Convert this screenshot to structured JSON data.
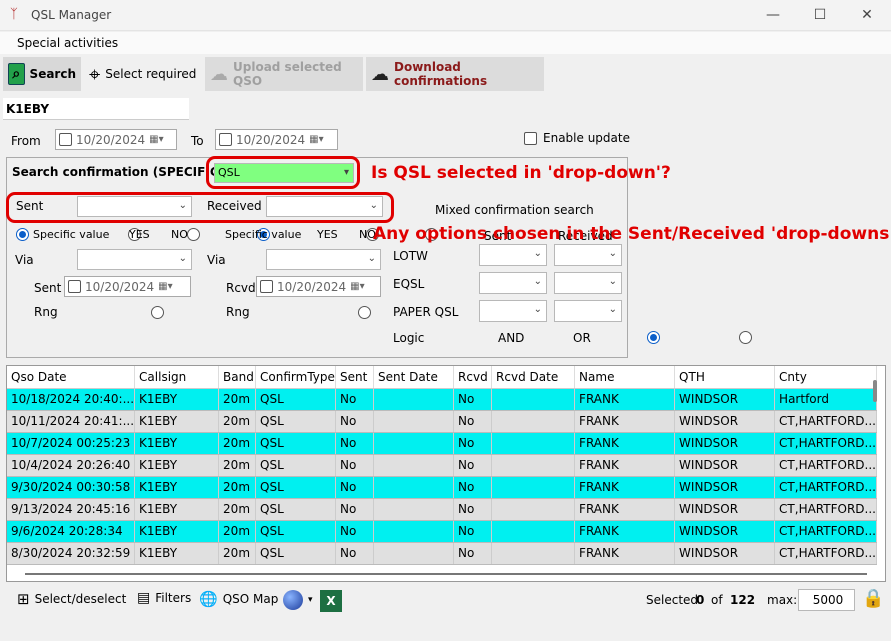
{
  "window": {
    "title": "QSL Manager",
    "minimize": "—",
    "maximize": "☐",
    "close": "✕"
  },
  "menu": {
    "special": "Special activities"
  },
  "toolbar": {
    "search": "Search",
    "select_required": "Select required",
    "upload": "Upload selected QSO",
    "download": "Download confirmations"
  },
  "callsign": "K1EBY",
  "dates": {
    "from_label": "From",
    "from_value": "10/20/2024",
    "to_label": "To",
    "to_value": "10/20/2024",
    "enable_update": "Enable update"
  },
  "search_conf": {
    "label": "Search confirmation (SPECIFIC)",
    "value": "QSL",
    "annotation": "Is QSL selected in 'drop-down'?"
  },
  "sent": {
    "label": "Sent",
    "value": "",
    "specific": "Specific value",
    "yes": "YES",
    "no": "NO",
    "via_label": "Via",
    "via_value": "",
    "date_label": "Sent",
    "date_value": "10/20/2024",
    "rng": "Rng"
  },
  "received": {
    "label": "Received",
    "value": "",
    "specific": "Specific value",
    "yes": "YES",
    "no": "NO",
    "via_label": "Via",
    "via_value": "",
    "date_label": "Rcvd",
    "date_value": "10/20/2024",
    "rng": "Rng"
  },
  "annotation2": "Any options chosen in the Sent/Received 'drop-downs'?",
  "mixed": {
    "title": "Mixed confirmation search",
    "sent_hdr": "Sent",
    "rcvd_hdr": "Received",
    "rows": [
      "LOTW",
      "EQSL",
      "PAPER QSL"
    ],
    "logic_label": "Logic",
    "and": "AND",
    "or": "OR"
  },
  "table": {
    "columns": [
      "Qso Date",
      "Callsign",
      "Band",
      "ConfirmType",
      "Sent",
      "Sent Date",
      "Rcvd",
      "Rcvd Date",
      "Name",
      "QTH",
      "Cnty"
    ],
    "rows": [
      [
        "10/18/2024 20:40:...",
        "K1EBY",
        "20m",
        "QSL",
        "No",
        "",
        "No",
        "",
        "FRANK",
        "WINDSOR",
        "Hartford"
      ],
      [
        "10/11/2024 20:41:...",
        "K1EBY",
        "20m",
        "QSL",
        "No",
        "",
        "No",
        "",
        "FRANK",
        "WINDSOR",
        "CT,HARTFORD..."
      ],
      [
        "10/7/2024 00:25:23",
        "K1EBY",
        "20m",
        "QSL",
        "No",
        "",
        "No",
        "",
        "FRANK",
        "WINDSOR",
        "CT,HARTFORD..."
      ],
      [
        "10/4/2024 20:26:40",
        "K1EBY",
        "20m",
        "QSL",
        "No",
        "",
        "No",
        "",
        "FRANK",
        "WINDSOR",
        "CT,HARTFORD..."
      ],
      [
        "9/30/2024 00:30:58",
        "K1EBY",
        "20m",
        "QSL",
        "No",
        "",
        "No",
        "",
        "FRANK",
        "WINDSOR",
        "CT,HARTFORD..."
      ],
      [
        "9/13/2024 20:45:16",
        "K1EBY",
        "20m",
        "QSL",
        "No",
        "",
        "No",
        "",
        "FRANK",
        "WINDSOR",
        "CT,HARTFORD..."
      ],
      [
        "9/6/2024 20:28:34",
        "K1EBY",
        "20m",
        "QSL",
        "No",
        "",
        "No",
        "",
        "FRANK",
        "WINDSOR",
        "CT,HARTFORD..."
      ],
      [
        "8/30/2024 20:32:59",
        "K1EBY",
        "20m",
        "QSL",
        "No",
        "",
        "No",
        "",
        "FRANK",
        "WINDSOR",
        "CT,HARTFORD..."
      ]
    ]
  },
  "status": {
    "select_deselect": "Select/deselect",
    "filters": "Filters",
    "qso_map": "QSO Map",
    "selected_label": "Selected",
    "selected_count": "0",
    "of": "of",
    "total": "122",
    "max_label": "max:",
    "max_value": "5000"
  },
  "colors": {
    "row_highlight": "#00f0f0",
    "row_alt": "#e0e0e0",
    "search_combo": "#80ff80",
    "annotation": "#e00000"
  }
}
